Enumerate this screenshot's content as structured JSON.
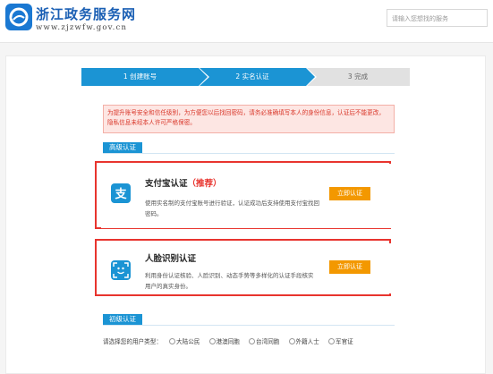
{
  "header": {
    "site_title": "浙江政务服务网",
    "site_url": "www.zjzwfw.gov.cn",
    "search_placeholder": "请输入您想找的服务"
  },
  "steps": [
    {
      "label": "1 创建账号",
      "state": "done"
    },
    {
      "label": "2 实名认证",
      "state": "active"
    },
    {
      "label": "3 完成",
      "state": "pending"
    }
  ],
  "notice": "为提升账号安全和信任级别，为方便您以后找回密码，请务必准确填写本人的身份信息，认证后不能更改，隐私信息未经本人许可严格保密。",
  "advanced": {
    "section_label": "高级认证",
    "alipay": {
      "title": "支付宝认证",
      "tag": "（推荐）",
      "desc": "使用实名制的支付宝账号进行验证，认证成功后支持使用支付宝找回密码。",
      "button": "立即认证",
      "icon": "alipay-icon"
    },
    "face": {
      "title": "人脸识别认证",
      "desc": "利用身份认证核验、人脸识别、动态手势等多样化的认证手段核实用户的真实身份。",
      "button": "立即认证",
      "icon": "face-recognition-icon"
    }
  },
  "basic": {
    "section_label": "初级认证",
    "user_type_label": "请选择您的用户类型：",
    "options": [
      "大陆公民",
      "港澳同胞",
      "台湾同胞",
      "外籍人士",
      "军官证"
    ]
  },
  "colors": {
    "primary": "#1b94d4",
    "highlight_frame": "#e8342e",
    "button": "#f39800"
  }
}
